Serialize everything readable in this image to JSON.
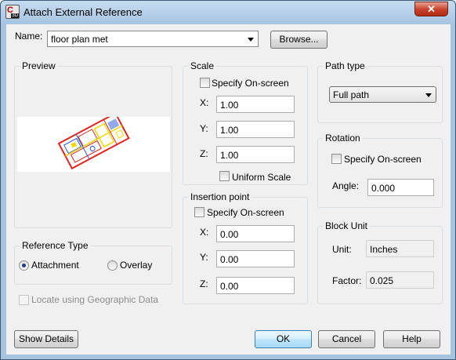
{
  "window": {
    "title": "Attach External Reference",
    "close_glyph": "✕",
    "icon": "autocad-app-icon"
  },
  "name": {
    "label": "Name:",
    "value": "floor plan met",
    "browse_label": "Browse..."
  },
  "preview": {
    "label": "Preview"
  },
  "reference_type": {
    "label": "Reference Type",
    "attachment_label": "Attachment",
    "overlay_label": "Overlay",
    "selected": "Attachment"
  },
  "geographic": {
    "label": "Locate using Geographic Data"
  },
  "scale": {
    "label": "Scale",
    "specify_label": "Specify On-screen",
    "x_label": "X:",
    "x": "1.00",
    "y_label": "Y:",
    "y": "1.00",
    "z_label": "Z:",
    "z": "1.00",
    "uniform_label": "Uniform Scale"
  },
  "insertion": {
    "label": "Insertion point",
    "specify_label": "Specify On-screen",
    "x_label": "X:",
    "x": "0.00",
    "y_label": "Y:",
    "y": "0.00",
    "z_label": "Z:",
    "z": "0.00"
  },
  "path_type": {
    "label": "Path type",
    "value": "Full path"
  },
  "rotation": {
    "label": "Rotation",
    "specify_label": "Specify On-screen",
    "angle_label": "Angle:",
    "angle": "0.000"
  },
  "block_unit": {
    "label": "Block Unit",
    "unit_label": "Unit:",
    "unit": "Inches",
    "factor_label": "Factor:",
    "factor": "0.025"
  },
  "footer": {
    "show_details": "Show Details",
    "ok": "OK",
    "cancel": "Cancel",
    "help": "Help"
  },
  "colors": {
    "title_bar": "#b8d2ec",
    "close_button": "#c7402a",
    "drawing_red": "#e0261e",
    "drawing_yellow": "#f0d800",
    "drawing_blue": "#2c56d8"
  }
}
